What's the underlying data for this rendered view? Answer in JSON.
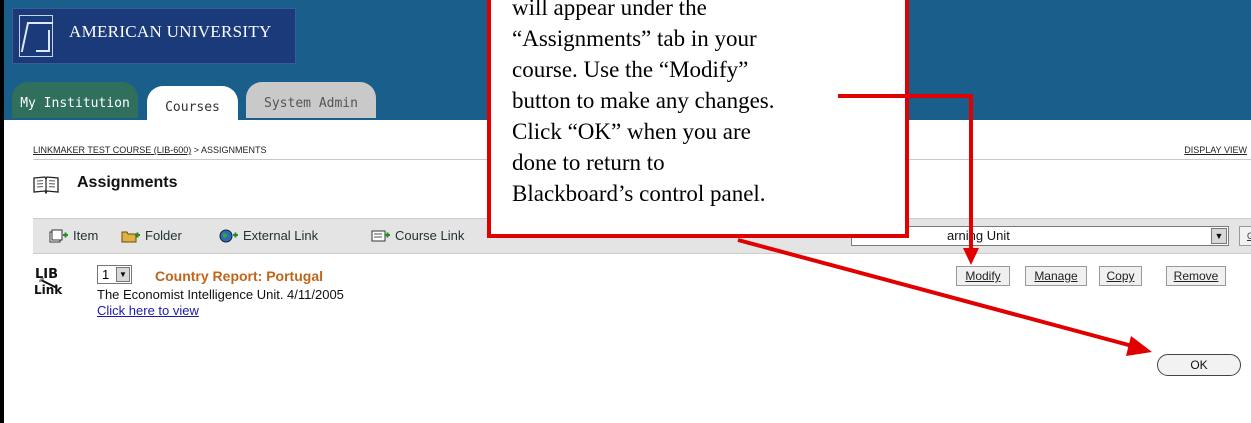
{
  "header": {
    "logo_text": "AMERICAN UNIVERSITY",
    "tabs": [
      {
        "label": "My Institution"
      },
      {
        "label": "Courses"
      },
      {
        "label": "System Admin"
      }
    ]
  },
  "breadcrumb": {
    "course": "LINKMAKER TEST COURSE (LIB-600)",
    "separator": " > ",
    "current": "ASSIGNMENTS"
  },
  "display_view": "DISPLAY VIEW",
  "page_title": "Assignments",
  "toolbar": {
    "item": "Item",
    "folder": "Folder",
    "external_link": "External Link",
    "course_link": "Course Link",
    "select_value": "arning Unit",
    "go": "Go"
  },
  "content_item": {
    "order": "1",
    "title": "Country Report: Portugal",
    "description": "The Economist Intelligence Unit. 4/11/2005",
    "link": "Click here to view",
    "actions": {
      "modify": "Modify",
      "manage": "Manage",
      "copy": "Copy",
      "remove": "Remove"
    }
  },
  "ok_label": "OK",
  "callout": {
    "lines": [
      "will appear under the",
      "“Assignments” tab in your",
      "course. Use the “Modify”",
      "button to make any changes.",
      "Click “OK” when you are",
      "done to return to",
      "Blackboard’s control panel."
    ]
  },
  "colors": {
    "header_bg": "#1a5e8c",
    "logo_bg": "#1b3a7a",
    "tab_active_inst": "#2f6f5c",
    "title_orange": "#c0651a",
    "callout_red": "#e00000"
  },
  "icons": [
    "book-icon",
    "item-add-icon",
    "folder-add-icon",
    "globe-link-icon",
    "course-link-icon",
    "liblink-icon",
    "dropdown-arrow-icon"
  ]
}
